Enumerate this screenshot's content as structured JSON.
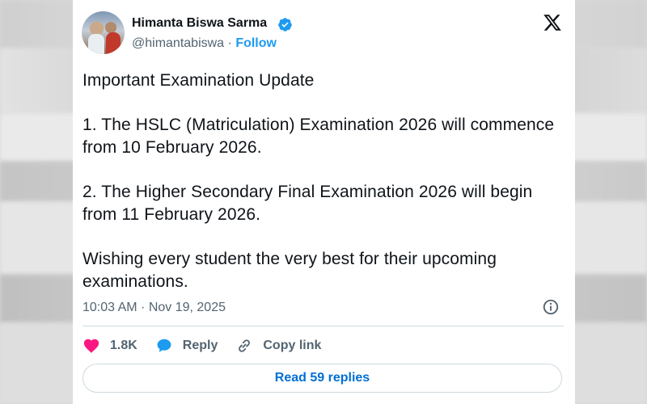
{
  "author": {
    "name": "Himanta Biswa Sarma",
    "handle": "@himantabiswa",
    "separator": "·",
    "follow_label": "Follow"
  },
  "tweet": {
    "lines": [
      "Important Examination Update",
      "1. The HSLC (Matriculation) Examination 2026 will commence from 10 February 2026.",
      "2. The Higher Secondary Final Examination 2026 will begin from 11 February 2026.",
      "Wishing every student the very best for their upcoming examinations."
    ],
    "timestamp": "10:03 AM · Nov 19, 2025"
  },
  "actions": {
    "like_count": "1.8K",
    "reply_label": "Reply",
    "copy_link_label": "Copy link",
    "read_replies_label": "Read 59 replies"
  },
  "colors": {
    "link_blue": "#1d9bf0",
    "like_red": "#f91880",
    "reply_blue": "#1d9bf0",
    "text": "#0f1419",
    "muted": "#536471"
  },
  "icons": {
    "verified": "verified-badge-icon",
    "logo": "x-logo-icon",
    "info": "info-icon",
    "like": "heart-icon",
    "reply": "speech-bubble-icon",
    "copy_link": "link-icon"
  }
}
